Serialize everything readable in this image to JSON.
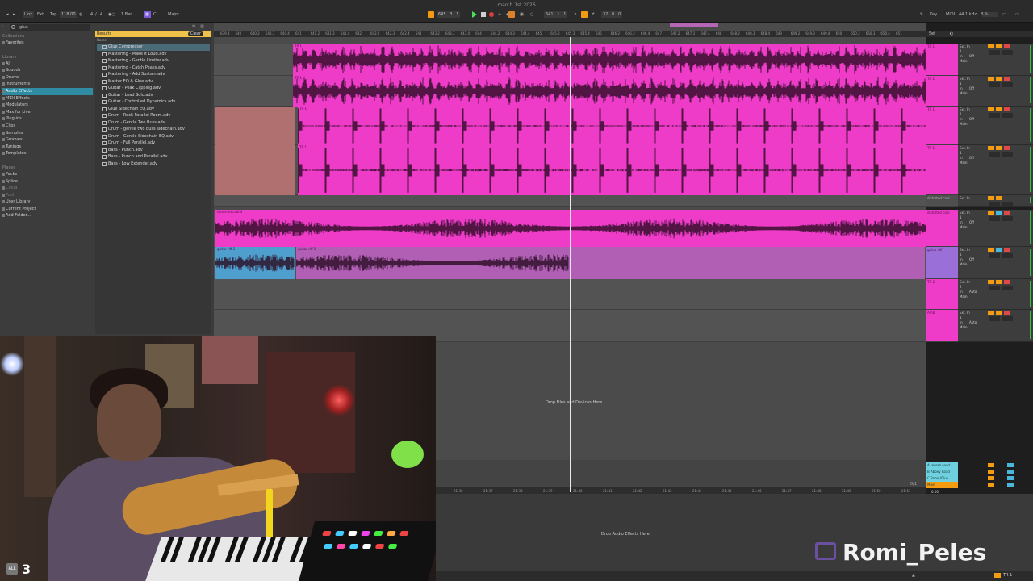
{
  "window": {
    "title": "march 1st 2026"
  },
  "transport": {
    "link": "Link",
    "ext": "Ext",
    "tap": "Tap",
    "tempo": "118.00",
    "sig_num": "4",
    "sig_den": "4",
    "quantize": "1 Bar",
    "key": "C",
    "scale": "Major",
    "position": "645 . 3 . 1",
    "loop_start": "641 . 1 . 1",
    "loop_len": "32 . 0 . 0",
    "key_label": "Key",
    "midi_label": "MIDI",
    "sample_rate": "44.1 kHz",
    "cpu": "8 %"
  },
  "browser": {
    "search_value": "glue",
    "collections_header": "Collections",
    "favorites": "Favorites",
    "library_header": "Library",
    "library_items": [
      "All",
      "Sounds",
      "Drums",
      "Instruments",
      "Audio Effects",
      "MIDI Effects",
      "Modulators",
      "Max for Live",
      "Plug-ins",
      "Clips",
      "Samples",
      "Grooves",
      "Tunings",
      "Templates"
    ],
    "places_header": "Places",
    "places_items": [
      "Packs",
      "Splice",
      "Cloud",
      "Push",
      "User Library",
      "Current Project",
      "Add Folder..."
    ],
    "results_label": "Results",
    "clear_label": "Clear",
    "name_column": "Name",
    "files": [
      "Glue Compressor",
      "Mastering - Make It Loud.adv",
      "Mastering - Gentle Limiter.adv",
      "Mastering - Catch Peaks.adv",
      "Mastering - Add Sustain.adv",
      "Master EQ & Glue.adv",
      "Guitar - Peak Clipping.adv",
      "Guitar - Lead Solo.adv",
      "Guitar - Controlled Dynamics.adv",
      "Glue Sidechain EQ.adv",
      "Drum - Rock Parallel Room.adv",
      "Drum - Gentle Two Buss.adv",
      "Drum - gentle two buss sidechain.adv",
      "Drum - Gentle Sidechain EQ.adv",
      "Drum - Full Parallel.adv",
      "Bass - Punch.adv",
      "Bass - Punch and Parallel.adv",
      "Bass - Low Extender.adv"
    ]
  },
  "ruler_ticks": [
    "639.4",
    "640",
    "640.2",
    "640.3",
    "640.4",
    "641",
    "641.2",
    "641.3",
    "641.4",
    "642",
    "642.2",
    "642.3",
    "642.4",
    "643",
    "643.2",
    "643.3",
    "643.4",
    "644",
    "644.2",
    "644.3",
    "644.4",
    "645",
    "645.2",
    "645.3",
    "645.4",
    "646",
    "646.2",
    "646.3",
    "646.4",
    "647",
    "647.2",
    "647.3",
    "647.4",
    "648",
    "648.2",
    "648.3",
    "648.4",
    "649",
    "649.2",
    "649.3",
    "649.4",
    "650",
    "650.2",
    "650.3",
    "650.4",
    "651"
  ],
  "time_ticks": [
    "21:36",
    "21:37",
    "21:38",
    "21:39",
    "21:40",
    "21:41",
    "21:42",
    "21:43",
    "21:44",
    "21:45",
    "21:46",
    "21:47",
    "21:48",
    "21:49",
    "21:50",
    "21:51"
  ],
  "tracks": [
    {
      "name": "TR 1",
      "clip": "TR 1",
      "color": "#ee3cc8"
    },
    {
      "name": "TR 1",
      "clip": "TR 1",
      "color": "#ee3cc8"
    },
    {
      "name": "TR 1",
      "clip": "TR 1",
      "color": "#ee3cc8"
    },
    {
      "name": "TR 1",
      "clip": "TR 1",
      "color": "#ee3cc8"
    },
    {
      "name": "distorted cabl",
      "clip": "",
      "color": "#4f4f4f"
    },
    {
      "name": "distorted cabl",
      "clip": "distorted cabl 4",
      "color": "#ee3cc8"
    },
    {
      "name": "guitar riff",
      "clip": "guitar riff 2",
      "color": "#9b6fd8"
    },
    {
      "name": "TR 2",
      "clip": "",
      "color": "#ee3cc8"
    },
    {
      "name": "Amb",
      "clip": "",
      "color": "#ee3cc8"
    }
  ],
  "io": {
    "input": "Ext. In",
    "monitor_in": "In",
    "monitor_auto": "Auto",
    "monitor_off": "Off",
    "output": "Main",
    "channel_1": "1",
    "channel_2": "2",
    "channel_34": "3/4"
  },
  "arrangement": {
    "drop_files": "Drop Files and Devices Here",
    "drop_audio_effects": "Drop Audio Effects Here"
  },
  "returns": [
    {
      "name": "A reverb send I",
      "color": "#6fd1e0"
    },
    {
      "name": "B Abbey Road",
      "color": "#6fd1e0"
    },
    {
      "name": "C Room/Glue",
      "color": "#6fd1e0"
    },
    {
      "name": "Main",
      "color": "#f39c12"
    }
  ],
  "footer": {
    "main_fraction": "0/1",
    "main_value": "0.00",
    "tr_label": "TR 1"
  },
  "stream": {
    "streamer_name": "Romi_Peles",
    "viewer_badge": "ALL",
    "viewer_count": "3"
  },
  "colors": {
    "clip_pink": "#ee3cc8",
    "clip_purple": "#b05fb5",
    "clip_blue": "#4f9fce",
    "accent_orange": "#f39c12",
    "accent_yellow": "#f0c24a",
    "selection_teal": "#2f8ca3"
  }
}
